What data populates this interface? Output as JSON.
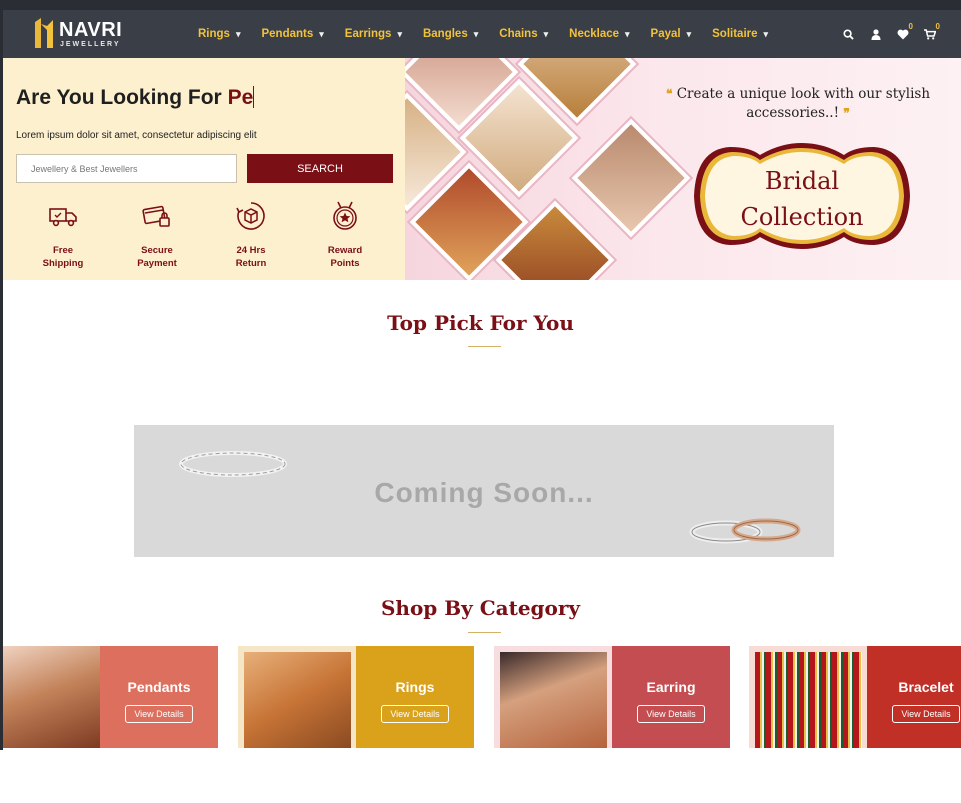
{
  "brand": {
    "name": "NAVRI",
    "tagline": "JEWELLERY"
  },
  "nav": {
    "menu": [
      {
        "label": "Rings"
      },
      {
        "label": "Pendants"
      },
      {
        "label": "Earrings"
      },
      {
        "label": "Bangles"
      },
      {
        "label": "Chains"
      },
      {
        "label": "Necklace"
      },
      {
        "label": "Payal"
      },
      {
        "label": "Solitaire"
      }
    ],
    "icons": [
      "search-icon",
      "user-icon",
      "heart-icon",
      "cart-icon"
    ],
    "wishlist_count": "0",
    "cart_count": "0"
  },
  "hero": {
    "title_static": "Are You Looking For ",
    "title_typed": "Pe",
    "description": "Lorem ipsum dolor sit amet, consectetur adipiscing elit",
    "search_placeholder": "Jewellery & Best Jewellers",
    "search_button": "SEARCH",
    "features": [
      {
        "line1": "Free",
        "line2": "Shipping",
        "icon": "truck-icon"
      },
      {
        "line1": "Secure",
        "line2": "Payment",
        "icon": "card-lock-icon"
      },
      {
        "line1": "24 Hrs",
        "line2": "Return",
        "icon": "return-box-icon"
      },
      {
        "line1": "Reward",
        "line2": "Points",
        "icon": "medal-star-icon"
      }
    ]
  },
  "banner": {
    "quote_line1": "Create a unique look with our stylish",
    "quote_line2": "accessories..!",
    "title_line1": "Bridal",
    "title_line2": "Collection"
  },
  "top_pick": {
    "title": "Top Pick For You",
    "placeholder_text": "Coming Soon..."
  },
  "shop_by_category": {
    "title": "Shop By Category",
    "items": [
      {
        "label": "Pendants",
        "button": "View Details",
        "color": "#dc6f5e"
      },
      {
        "label": "Rings",
        "button": "View Details",
        "color": "#d9a21a"
      },
      {
        "label": "Earring",
        "button": "View Details",
        "color": "#c34d51"
      },
      {
        "label": "Bracelet",
        "button": "View Details",
        "color": "#c13027"
      }
    ]
  },
  "colors": {
    "nav_bg": "#3a3f47",
    "accent_gold": "#f2c23c",
    "maroon": "#7a0f16",
    "hero_cream": "#fdf0cf"
  }
}
